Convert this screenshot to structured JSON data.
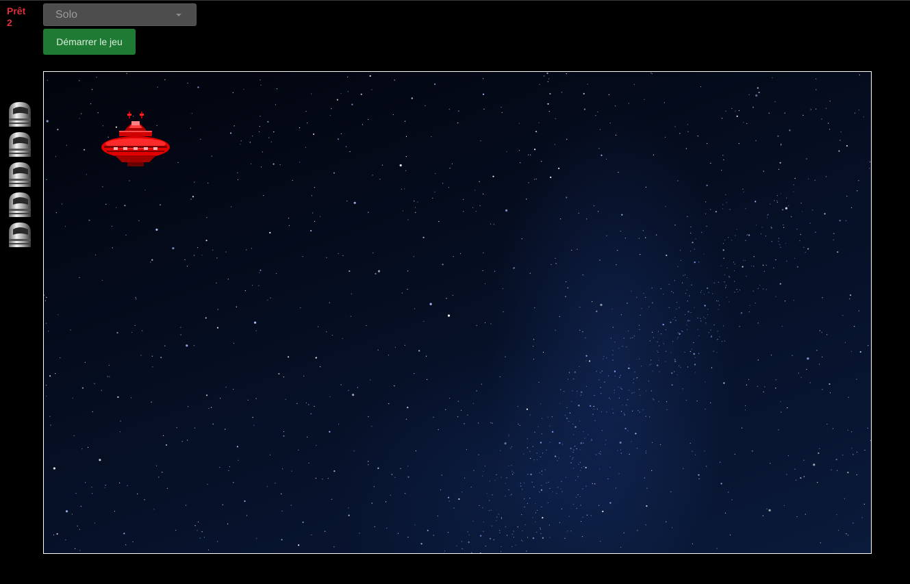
{
  "status": {
    "label": "Prêt",
    "count": "2"
  },
  "controls": {
    "mode_select": {
      "selected": "Solo"
    },
    "start_button": "Démarrer le jeu"
  },
  "lives": {
    "count": 5,
    "icon": "helmet-icon"
  },
  "game": {
    "background": "starfield",
    "enemy": "red-ufo",
    "colors": {
      "status_text": "#e0303a",
      "start_button": "#1f7a34",
      "ufo": "#e00000"
    }
  }
}
